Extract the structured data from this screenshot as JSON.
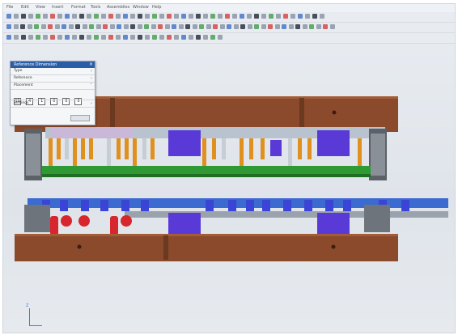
{
  "app": {
    "menu_items": [
      "File",
      "Edit",
      "View",
      "Insert",
      "Format",
      "Tools",
      "Assemblies",
      "Window",
      "Help"
    ]
  },
  "dialog": {
    "title": "Reference Dimension",
    "rows": [
      "Type",
      "Reference",
      "Placement"
    ],
    "digits": [
      "10",
      "4",
      "1",
      "0",
      "0",
      "0"
    ],
    "footer_row": "Settings",
    "close": "×"
  },
  "axis": {
    "label": "Z"
  },
  "colors": {
    "plate_brown": "#8b4a2b",
    "guide_green": "#2f9a34",
    "punch_orange": "#e0901e",
    "part_blue": "#5a3ad6",
    "strip_grey": "#9aa3ad",
    "spring_red": "#d8262e"
  }
}
